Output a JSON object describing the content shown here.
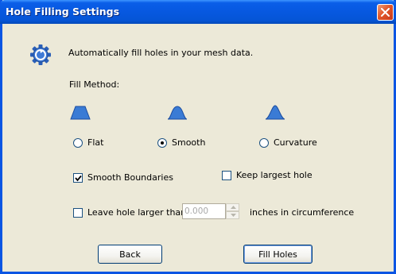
{
  "window": {
    "title": "Hole Filling Settings",
    "close_icon": "close-icon",
    "accent": "#0a55e3",
    "background": "#ece9d8"
  },
  "intro": {
    "icon": "gear-icon",
    "text": "Automatically fill holes in your mesh data."
  },
  "fill_method": {
    "label": "Fill Method:",
    "options": [
      {
        "label": "Flat",
        "icon": "flat-profile-icon",
        "selected": false
      },
      {
        "label": "Smooth",
        "icon": "smooth-profile-icon",
        "selected": true
      },
      {
        "label": "Curvature",
        "icon": "curvature-profile-icon",
        "selected": false
      }
    ]
  },
  "smooth_boundaries": {
    "label": "Smooth Boundaries",
    "checked": true
  },
  "keep_largest_hole": {
    "label": "Keep largest hole",
    "checked": false
  },
  "leave_hole": {
    "label": "Leave hole larger than",
    "checked": false,
    "value": "0.000",
    "suffix": "inches in circumference"
  },
  "buttons": {
    "back": "Back",
    "fill_holes": "Fill Holes"
  }
}
